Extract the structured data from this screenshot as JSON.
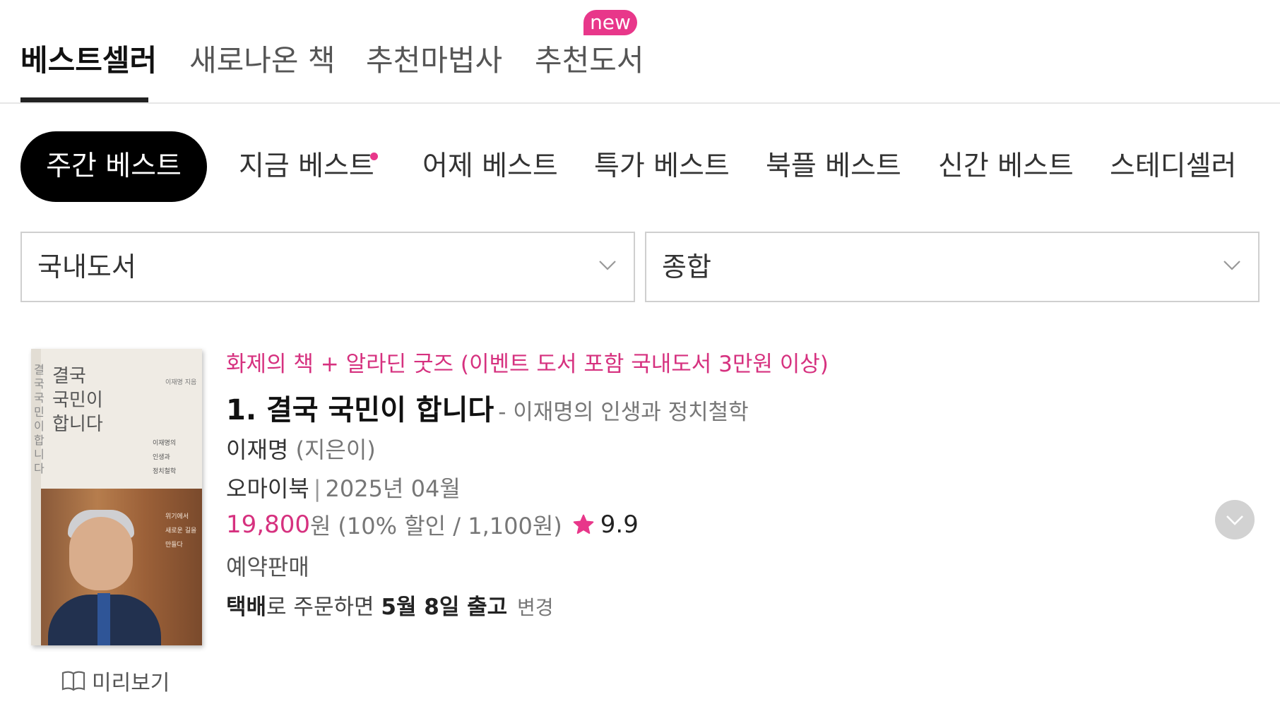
{
  "top_tabs": [
    {
      "label": "베스트셀러",
      "active": true
    },
    {
      "label": "새로나온 책",
      "active": false
    },
    {
      "label": "추천마법사",
      "active": false
    },
    {
      "label": "추천도서",
      "active": false
    }
  ],
  "new_badge": "new",
  "filter_pills": [
    {
      "label": "주간 베스트",
      "active": true
    },
    {
      "label": "지금 베스트",
      "dot": true
    },
    {
      "label": "어제 베스트"
    },
    {
      "label": "특가 베스트"
    },
    {
      "label": "북플 베스트"
    },
    {
      "label": "신간 베스트"
    },
    {
      "label": "스테디셀러"
    }
  ],
  "selects": {
    "category": "국내도서",
    "subcategory": "종합"
  },
  "book": {
    "promo": "화제의 책 + 알라딘 굿즈 (이벤트 도서 포함 국내도서 3만원 이상)",
    "rank_title": "1. 결국 국민이 합니다",
    "subtitle": "- 이재명의 인생과 정치철학",
    "author": "이재명",
    "author_role": "(지은이)",
    "publisher": "오마이북",
    "separator": "|",
    "pub_date": "2025년 04월",
    "price": "19,800",
    "currency": "원",
    "discount": "(10% 할인 / 1,100원)",
    "rating": "9.9",
    "status": "예약판매",
    "delivery": {
      "method": "택배",
      "text": "로 주문하면",
      "date": "5월 8일 출고",
      "change": "변경"
    },
    "preview": "미리보기",
    "cover": {
      "title_lines": [
        "결국",
        "국민이",
        "합니다"
      ],
      "vertical_text": "결국 국민이 합니다",
      "author": "이재명 지음",
      "sub_lines": [
        "이재명의",
        "인생과",
        "정치철학"
      ],
      "caption_lines": [
        "위기에서",
        "새로운 길을",
        "만들다"
      ]
    }
  },
  "colors": {
    "accent_pink": "#e8378a",
    "price_pink": "#d6317f",
    "active_pill_bg": "#000000"
  },
  "icons": {
    "select_arrow": "chevron-down-icon",
    "rating": "star-icon",
    "preview": "book-open-icon",
    "expand": "chevron-down-icon"
  }
}
